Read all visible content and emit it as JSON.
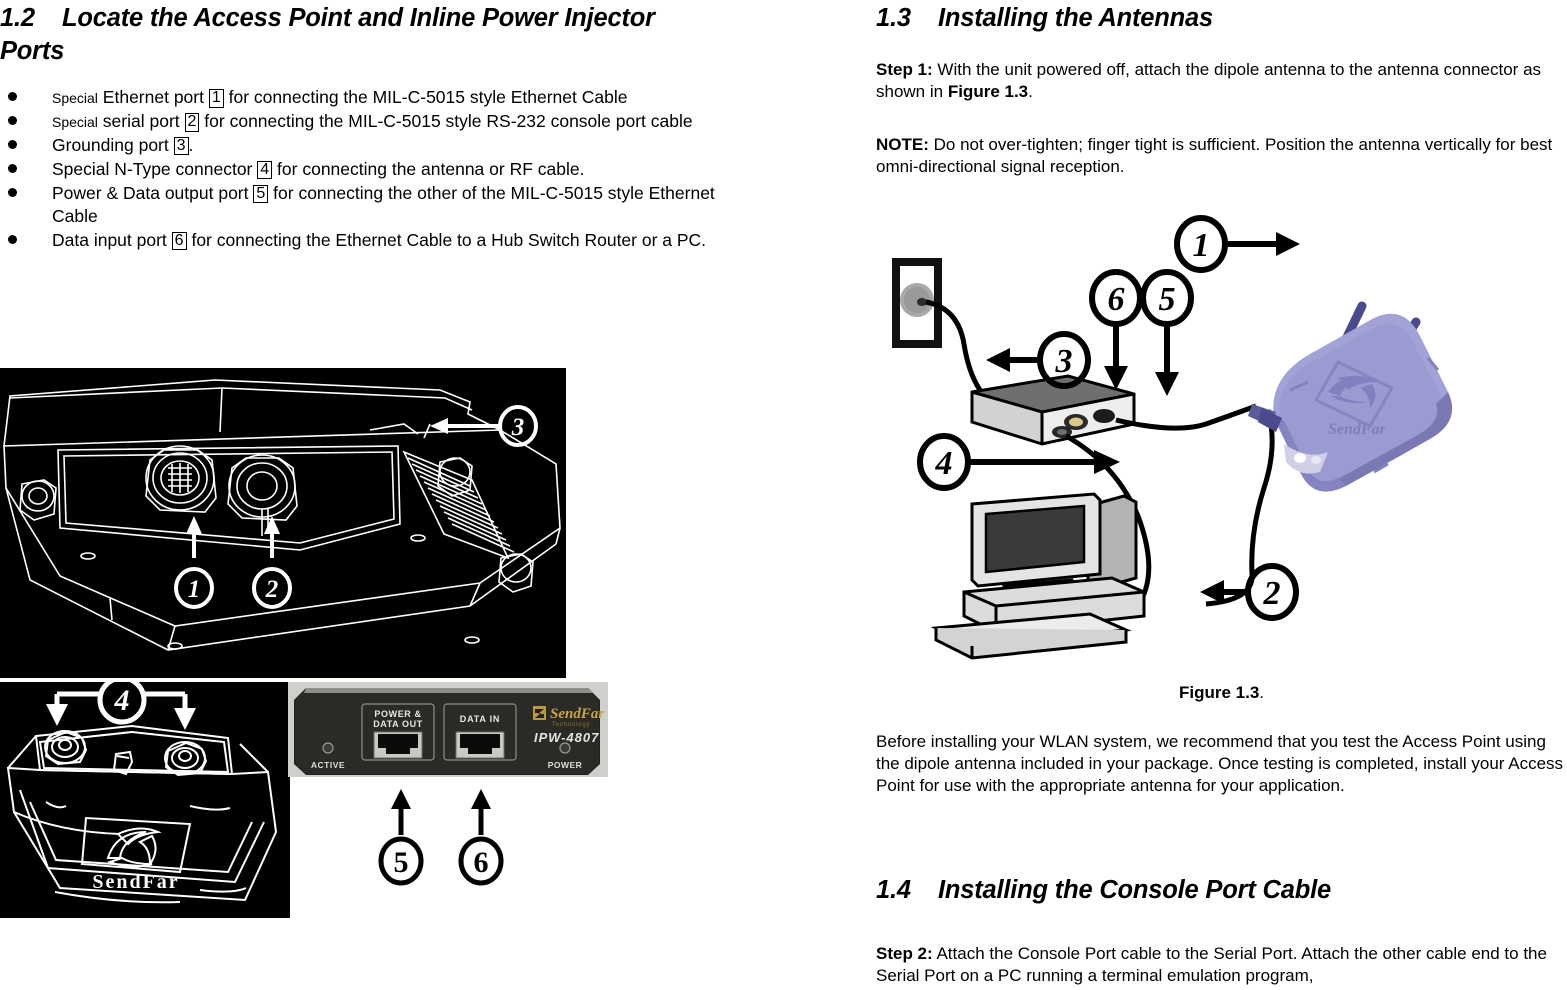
{
  "document": {
    "left_column": {
      "heading": {
        "number": "1.2",
        "title": "Locate the Access Point and Inline Power Injector Ports"
      },
      "bullets": [
        {
          "prefix_small": "Special",
          "text_before": "Ethernet port",
          "box": "1",
          "text_after": "for connecting the MIL-C-5015 style Ethernet Cable"
        },
        {
          "prefix_small": "Special",
          "text_before": "serial port",
          "box": "2",
          "text_after": "for connecting the MIL-C-5015 style RS-232 console port cable"
        },
        {
          "prefix_small": "",
          "text_before": "Grounding port",
          "box": "3",
          "text_after": "."
        },
        {
          "prefix_small": "",
          "text_before": "Special N-Type connector",
          "box": "4",
          "text_after": "for connecting the antenna or RF cable."
        },
        {
          "prefix_small": "",
          "text_before": "Power & Data output port",
          "box": "5",
          "text_after": "for connecting the other of the MIL-C-5015 style Ethernet Cable"
        },
        {
          "prefix_small": "",
          "text_before": "Data input port",
          "box": "6",
          "text_after": "for connecting the Ethernet Cable to a Hub Switch Router or a PC."
        }
      ],
      "figure_enclosure": {
        "alt": "Line drawing of access point enclosure underside showing ports",
        "callouts": [
          "1",
          "2",
          "3"
        ]
      },
      "figure_bottom_enclosure": {
        "alt": "Line drawing of access point bottom with N-type connectors",
        "callouts": [
          "4"
        ],
        "brand": "SendFar"
      },
      "figure_injector": {
        "alt": "Photo of inline power injector front panel",
        "port_left_label_line1": "POWER &",
        "port_left_label_line2": "DATA OUT",
        "port_right_label": "DATA  IN",
        "led_left_label": "ACTIVE",
        "led_right_label": "POWER",
        "brand": "SendFar",
        "brand_sub": "Technology",
        "model": "IPW-4807",
        "callouts": [
          "5",
          "6"
        ]
      }
    },
    "right_column": {
      "heading_13": {
        "number": "1.3",
        "title": "Installing the Antennas"
      },
      "step1": {
        "label": "Step 1:",
        "text_part1": " With the unit powered off, attach the dipole antenna to the antenna connector as shown in ",
        "bold_ref": "Figure 1.3",
        "text_part2": "."
      },
      "note": {
        "label": "NOTE:",
        "text": " Do not over-tighten; finger tight is sufficient. Position the antenna vertically for best omni-directional signal reception."
      },
      "figure_13": {
        "caption_bold": "Figure 1.3",
        "caption_period": ".",
        "alt": "Diagram of access point connected to power injector, wall outlet and PC",
        "access_point_brand": "SendFar",
        "callouts": [
          "1",
          "2",
          "3",
          "4",
          "5",
          "6"
        ]
      },
      "paragraph_before": "Before installing your WLAN system, we recommend that you test the Access Point using the dipole antenna included in your package. Once testing is completed, install your Access Point for use with the appropriate antenna for your application.",
      "heading_14": {
        "number": "1.4",
        "title": "Installing the Console Port Cable"
      },
      "step2": {
        "label": "Step 2:",
        "text": " Attach the Console Port cable to the Serial Port. Attach the other cable end to the Serial Port on a PC running a terminal emulation program,"
      }
    },
    "colors": {
      "lineart_bg": "#000000",
      "lineart_stroke": "#ffffff",
      "access_point_body": "#9b9ad1",
      "access_point_body_dark": "#7a79b4",
      "antenna": "#4a4a8c",
      "injector_panel": "#1d1c17",
      "injector_brand_gold": "#b99a3e",
      "device_gray": "#b8b8b8",
      "text": "#000000"
    }
  }
}
